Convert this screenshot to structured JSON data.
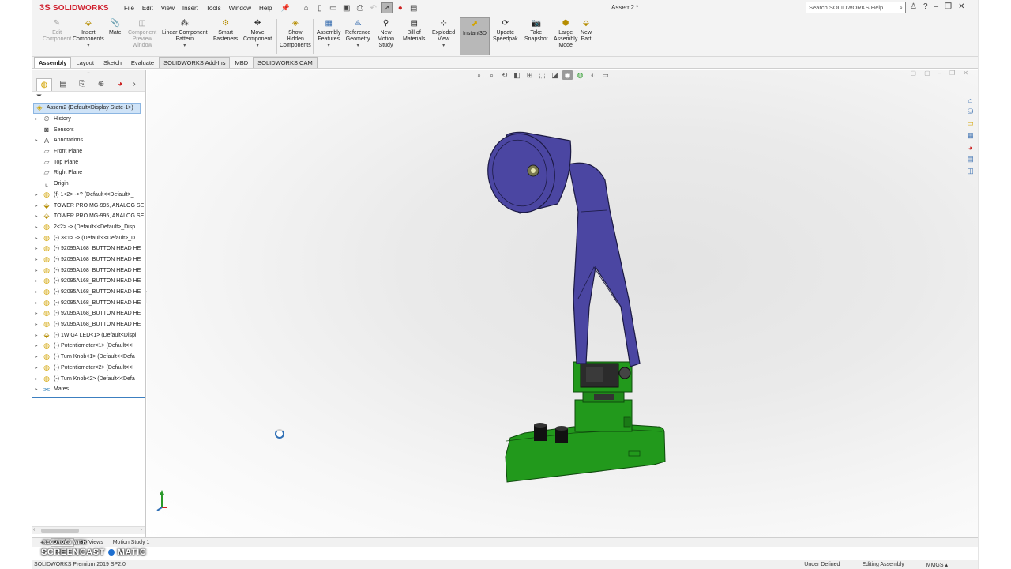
{
  "app": {
    "brand": "SOLIDWORKS",
    "brand_mark": "3S",
    "document_title": "Assem2 *",
    "menu": [
      "File",
      "Edit",
      "View",
      "Insert",
      "Tools",
      "Window",
      "Help"
    ],
    "search_placeholder": "Search SOLIDWORKS Help"
  },
  "command_manager": {
    "buttons": [
      {
        "label": "Edit\nComponent",
        "disabled": true
      },
      {
        "label": "Insert\nComponents"
      },
      {
        "label": "Mate"
      },
      {
        "label": "Component\nPreview\nWindow",
        "disabled": true
      },
      {
        "label": "Linear Component\nPattern"
      },
      {
        "label": "Smart\nFasteners"
      },
      {
        "label": "Move\nComponent"
      },
      {
        "label": "Show\nHidden\nComponents"
      },
      {
        "label": "Assembly\nFeatures"
      },
      {
        "label": "Reference\nGeometry"
      },
      {
        "label": "New\nMotion\nStudy"
      },
      {
        "label": "Bill of\nMaterials"
      },
      {
        "label": "Exploded\nView"
      },
      {
        "label": "Instant3D",
        "active": true
      },
      {
        "label": "Update\nSpeedpak"
      },
      {
        "label": "Take\nSnapshot"
      },
      {
        "label": "Large\nAssembly\nMode"
      },
      {
        "label": "New\nPart"
      }
    ],
    "tabs": [
      "Assembly",
      "Layout",
      "Sketch",
      "Evaluate",
      "SOLIDWORKS Add-Ins",
      "MBD",
      "SOLIDWORKS CAM"
    ]
  },
  "feature_tree": {
    "root": "Assem2  (Default<Display State-1>)",
    "items": [
      {
        "label": "History",
        "icon": "history-icon",
        "expand": true
      },
      {
        "label": "Sensors",
        "icon": "sensor-icon",
        "expand": false
      },
      {
        "label": "Annotations",
        "icon": "annotation-icon",
        "expand": true
      },
      {
        "label": "Front Plane",
        "icon": "plane-icon",
        "expand": false
      },
      {
        "label": "Top Plane",
        "icon": "plane-icon",
        "expand": false
      },
      {
        "label": "Right Plane",
        "icon": "plane-icon",
        "expand": false
      },
      {
        "label": "Origin",
        "icon": "origin-icon",
        "expand": false
      },
      {
        "label": "(f) 1<2> ->? (Default<<Default>_",
        "icon": "part-icon",
        "expand": true
      },
      {
        "label": "TOWER PRO MG-995, ANALOG SE",
        "icon": "subassembly-icon",
        "expand": true
      },
      {
        "label": "TOWER PRO MG-995, ANALOG SE",
        "icon": "subassembly-icon",
        "expand": true
      },
      {
        "label": "2<2> -> (Default<<Default>_Disp",
        "icon": "part-icon",
        "expand": true
      },
      {
        "label": "(-) 3<1> -> (Default<<Default>_D",
        "icon": "part-icon",
        "expand": true
      },
      {
        "label": "(-) 92095A168_BUTTON HEAD HE",
        "icon": "part-icon",
        "expand": true
      },
      {
        "label": "(-) 92095A168_BUTTON HEAD HE",
        "icon": "part-icon",
        "expand": true
      },
      {
        "label": "(-) 92095A168_BUTTON HEAD HE",
        "icon": "part-icon",
        "expand": true
      },
      {
        "label": "(-) 92095A168_BUTTON HEAD HE",
        "icon": "part-icon",
        "expand": true
      },
      {
        "label": "(-) 92095A168_BUTTON HEAD HE",
        "icon": "part-icon",
        "expand": true
      },
      {
        "label": "(-) 92095A168_BUTTON HEAD HE",
        "icon": "part-icon",
        "expand": true
      },
      {
        "label": "(-) 92095A168_BUTTON HEAD HE",
        "icon": "part-icon",
        "expand": true
      },
      {
        "label": "(-) 92095A168_BUTTON HEAD HE",
        "icon": "part-icon",
        "expand": true
      },
      {
        "label": "(-) 1W G4 LED<1> (Default<Displ",
        "icon": "subassembly-icon",
        "expand": true
      },
      {
        "label": "(-) Potentiometer<1> (Default<<I",
        "icon": "part-icon",
        "expand": true
      },
      {
        "label": "(-) Turn Knob<1> (Default<<Defa",
        "icon": "part-icon",
        "expand": true
      },
      {
        "label": "(-) Potentiometer<2> (Default<<I",
        "icon": "part-icon",
        "expand": true
      },
      {
        "label": "(-) Turn Knob<2> (Default<<Defa",
        "icon": "part-icon",
        "expand": true
      },
      {
        "label": "Mates",
        "icon": "mates-icon",
        "expand": true
      }
    ]
  },
  "bottom_tabs": [
    "Model",
    "3D Views",
    "Motion Study 1"
  ],
  "status": {
    "product": "SOLIDWORKS Premium 2019 SP2.0",
    "state": "Under Defined",
    "mode": "Editing Assembly",
    "units": "MMGS"
  },
  "watermark": {
    "line1": "RECORDED WITH",
    "line2a": "SCREENCAST",
    "line2b": "MATIC"
  },
  "colors": {
    "lamp_body": "#4b46a2",
    "lamp_edge": "#1c1a44",
    "base": "#22991c",
    "base_edge": "#0f4a0d",
    "brand": "#d0202e",
    "selection": "#cfe3f7"
  }
}
